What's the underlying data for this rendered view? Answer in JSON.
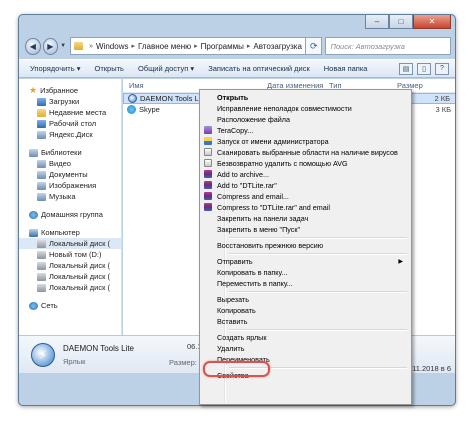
{
  "window": {
    "buttons": [
      "–",
      "□",
      "✕"
    ]
  },
  "address": {
    "segments": [
      "Windows",
      "Главное меню",
      "Программы",
      "Автозагрузка"
    ],
    "search_placeholder": "Поиск: Автозагрузка"
  },
  "toolbar": {
    "items": [
      "Упорядочить ▾",
      "Открыть",
      "Общий доступ ▾",
      "Записать на оптический диск",
      "Новая папка"
    ]
  },
  "sidebar": {
    "favorites": "Избранное",
    "fav_items": [
      "Загрузки",
      "Недавние места",
      "Рабочий стол",
      "Яндекс.Диск"
    ],
    "libraries": "Библиотеки",
    "lib_items": [
      "Видео",
      "Документы",
      "Изображения",
      "Музыка"
    ],
    "homegroup": "Домашняя группа",
    "computer": "Компьютер",
    "disks": [
      "Локальный диск (",
      "Новый том (D:)",
      "Локальный диск (",
      "Локальный диск (",
      "Локальный диск ("
    ],
    "network": "Сеть"
  },
  "columns": {
    "name": "Имя",
    "date": "Дата изменения",
    "type": "Тип",
    "size": "Размер"
  },
  "files": [
    {
      "name": "DAEMON Tools Lite",
      "size": "2 КБ"
    },
    {
      "name": "Skype",
      "size": "3 КБ"
    }
  ],
  "details": {
    "title": "DAEMON Tools Lite",
    "date_prefix": "06.12",
    "subtitle": "Ярлык",
    "size_prefix": "Размер: 1",
    "created": "27.11.2018 в 6"
  },
  "context_menu": {
    "open": "Открыть",
    "fix_compat": "Исправление неполадок совместимости",
    "file_location": "Расположение файла",
    "teracopy": "TeraCopy...",
    "run_admin": "Запуск от имени администратора",
    "scan": "Сканировать выбранные области на наличие вирусов",
    "avg_delete": "Безвозвратно удалить с помощью AVG",
    "add_archive": "Add to archive...",
    "add_rar": "Add to \"DTLite.rar\"",
    "compress_email": "Compress and email...",
    "compress_rar_email": "Compress to \"DTLite.rar\" and email",
    "pin_taskbar": "Закрепить на панели задач",
    "pin_start": "Закрепить в меню \"Пуск\"",
    "restore": "Восстановить прежнюю версию",
    "send_to": "Отправить",
    "copy_to": "Копировать в папку...",
    "move_to": "Переместить в папку...",
    "cut": "Вырезать",
    "copy": "Копировать",
    "paste": "Вставить",
    "create_shortcut": "Создать ярлык",
    "delete": "Удалить",
    "rename": "Переименовать",
    "properties": "Свойства"
  },
  "colors": {
    "highlight": "#d9534f",
    "selection": "#cfe3fa"
  }
}
